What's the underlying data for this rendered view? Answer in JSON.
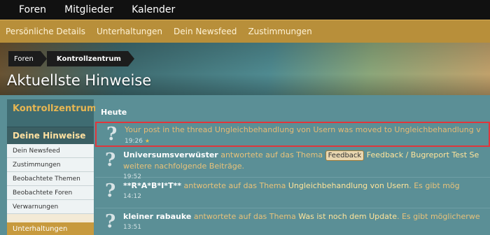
{
  "topnav": {
    "items": [
      "Foren",
      "Mitglieder",
      "Kalender"
    ]
  },
  "subnav": {
    "items": [
      "Persönliche Details",
      "Unterhaltungen",
      "Dein Newsfeed",
      "Zustimmungen"
    ]
  },
  "breadcrumb": {
    "items": [
      "Foren",
      "Kontrollzentrum"
    ]
  },
  "page_title": "Aktuellste Hinweise",
  "sidebar": {
    "header": "Kontrollzentrum",
    "active": "Deine Hinweise",
    "items": [
      "Dein Newsfeed",
      "Zustimmungen",
      "Beobachtete Themen",
      "Beobachtete Foren",
      "Verwarnungen"
    ],
    "bottom": "Unterhaltungen"
  },
  "main": {
    "section": "Heute",
    "notes": [
      {
        "text": "Your post in the thread Ungleichbehandlung von Usern was moved to Ungleichbehandlung v",
        "time": "19:26"
      },
      {
        "user": "Universumsverwüster",
        "action": " antwortete auf das Thema ",
        "badge": "Feedback",
        "link": " Feedback / Bugreport Test Se",
        "line2": "weitere nachfolgende Beiträge.",
        "time": "19:52"
      },
      {
        "user": "**R*A*B*I*T**",
        "action": " antwortete auf das Thema ",
        "link": "Ungleichbehandlung von Usern",
        "rest": ". Es gibt mög",
        "time": "14:12"
      },
      {
        "user": "kleiner rabauke",
        "action": " antwortete auf das Thema ",
        "link": "Was ist noch dem Update",
        "rest": ". Es gibt möglicherwe",
        "time": "13:51"
      }
    ]
  }
}
